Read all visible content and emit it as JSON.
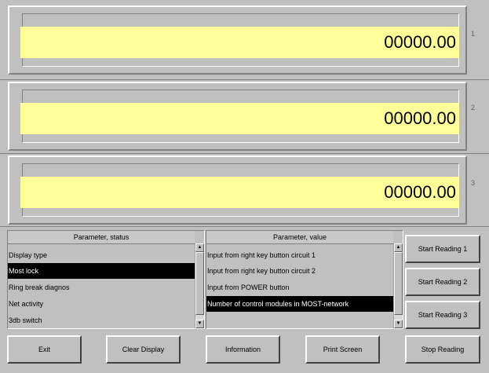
{
  "panels": [
    {
      "value": "00000.00",
      "number": "1"
    },
    {
      "value": "00000.00",
      "number": "2"
    },
    {
      "value": "00000.00",
      "number": "3"
    }
  ],
  "status_list": {
    "header": "Parameter, status",
    "items": [
      "Display type",
      "Most lock",
      "Ring break diagnos",
      "Net activity",
      "3db switch"
    ],
    "selected_index": 1
  },
  "value_list": {
    "header": "Parameter, value",
    "items": [
      "Input from right key button circuit 1",
      "Input from right key button circuit 2",
      "Input from POWER button",
      "Number of control modules in MOST-network"
    ],
    "selected_index": 3
  },
  "side_buttons": {
    "start1": "Start Reading 1",
    "start2": "Start Reading 2",
    "start3": "Start Reading 3"
  },
  "bottom_buttons": {
    "exit": "Exit",
    "clear": "Clear Display",
    "info": "Information",
    "print": "Print Screen",
    "stop": "Stop Reading"
  },
  "colors": {
    "background": "#c0c0c0",
    "readout": "#ffff99",
    "selection": "#000000"
  }
}
